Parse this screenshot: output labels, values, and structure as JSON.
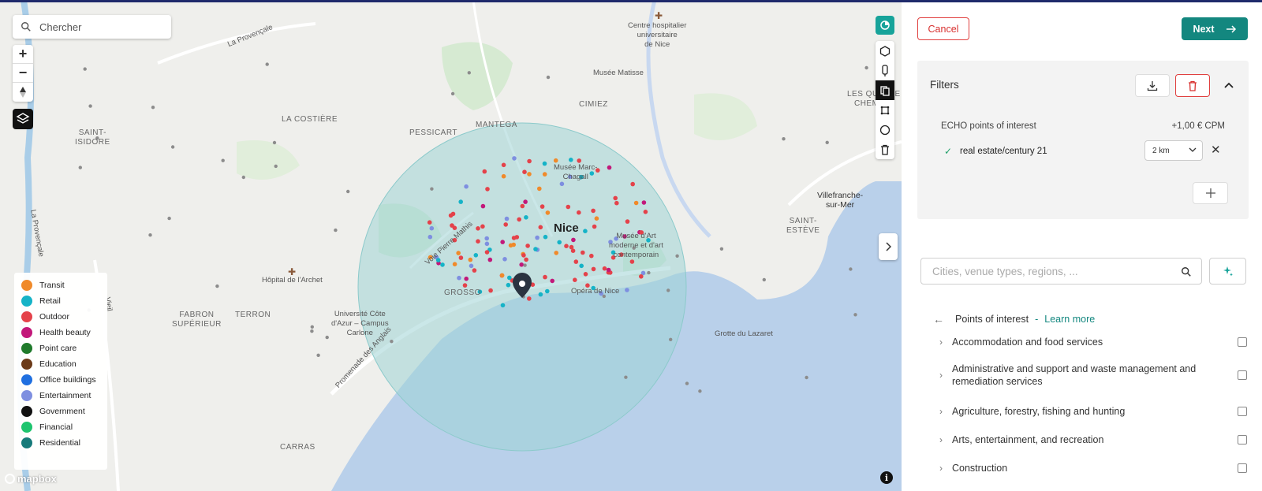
{
  "map": {
    "search_placeholder": "Chercher",
    "zoom_in": "+",
    "zoom_out": "−",
    "attribution": "mapbox",
    "info": "i",
    "labels": {
      "la_provencale_top": "La Provençale",
      "la_provencale_left": "La Provençale",
      "saint_isidore": "SAINT-\nISIDORE",
      "la_costiere": "LA COSTIÈRE",
      "pessicart": "PESSICART",
      "mantega": "MANTEGA",
      "cimiez": "CIMIEZ",
      "chu": "Centre hospitalier\nuniversitaire\nde Nice",
      "musee_matisse": "Musée Matisse",
      "musee_chagall": "Musée Marc-\nChagall",
      "les_quatre_chemins": "LES QUATRE\nCHEMINS",
      "villefranche": "Villefranche-\nsur-Mer",
      "saint_esteve": "SAINT-\nESTÈVE",
      "nice": "Nice",
      "mamac": "Musée d'Art\nmoderne et d'art\ncontemporain",
      "voie_pierre_mathis": "Voie Pierre Mathis",
      "hopital_archet": "Hôpital de l'Archet",
      "grosso": "GROSSO",
      "opera": "Opéra de Nice",
      "fabron": "FABRON\nSUPÉRIEUR",
      "terron": "TERRON",
      "universite": "Université Côte\nd'Azur – Campus\nCarlone",
      "grotte": "Grotte du Lazaret",
      "promenade": "Promenade des Anglais",
      "carras": "CARRAS",
      "vieil": "Vieil"
    }
  },
  "legend": [
    {
      "label": "Transit",
      "color": "#f08a2a",
      "icon": "bus-icon"
    },
    {
      "label": "Retail",
      "color": "#15b3c7",
      "icon": "cart-icon"
    },
    {
      "label": "Outdoor",
      "color": "#e4424a",
      "icon": "tree-icon"
    },
    {
      "label": "Health beauty",
      "color": "#c2187a",
      "icon": "heart-icon"
    },
    {
      "label": "Point care",
      "color": "#1f7a2b",
      "icon": "cross-icon"
    },
    {
      "label": "Education",
      "color": "#6b3a18",
      "icon": "graduation-icon"
    },
    {
      "label": "Office buildings",
      "color": "#1f6fe0",
      "icon": "briefcase-icon"
    },
    {
      "label": "Entertainment",
      "color": "#7e8fe0",
      "icon": "glass-icon"
    },
    {
      "label": "Government",
      "color": "#111111",
      "icon": "building-icon"
    },
    {
      "label": "Financial",
      "color": "#1dc46e",
      "icon": "money-icon"
    },
    {
      "label": "Residential",
      "color": "#167a7a",
      "icon": "home-icon"
    }
  ],
  "header": {
    "cancel_label": "Cancel",
    "next_label": "Next"
  },
  "filters": {
    "title": "Filters",
    "poi_label": "ECHO points of interest",
    "cpm": "+1,00 € CPM",
    "item": "real estate/century 21",
    "radius": "2 km"
  },
  "search": {
    "placeholder": "Cities, venue types, regions, ..."
  },
  "breadcrumb": {
    "label": "Points of interest",
    "separator": "-",
    "learn_more": "Learn more"
  },
  "categories": [
    "Accommodation and food services",
    "Administrative and support and waste management and remediation services",
    "Agriculture, forestry, fishing and hunting",
    "Arts, entertainment, and recreation",
    "Construction"
  ],
  "colors": {
    "accent": "#13877f",
    "danger": "#d8302f",
    "sea": "#b9d0ea",
    "radius_fill": "#9fd4d6"
  }
}
